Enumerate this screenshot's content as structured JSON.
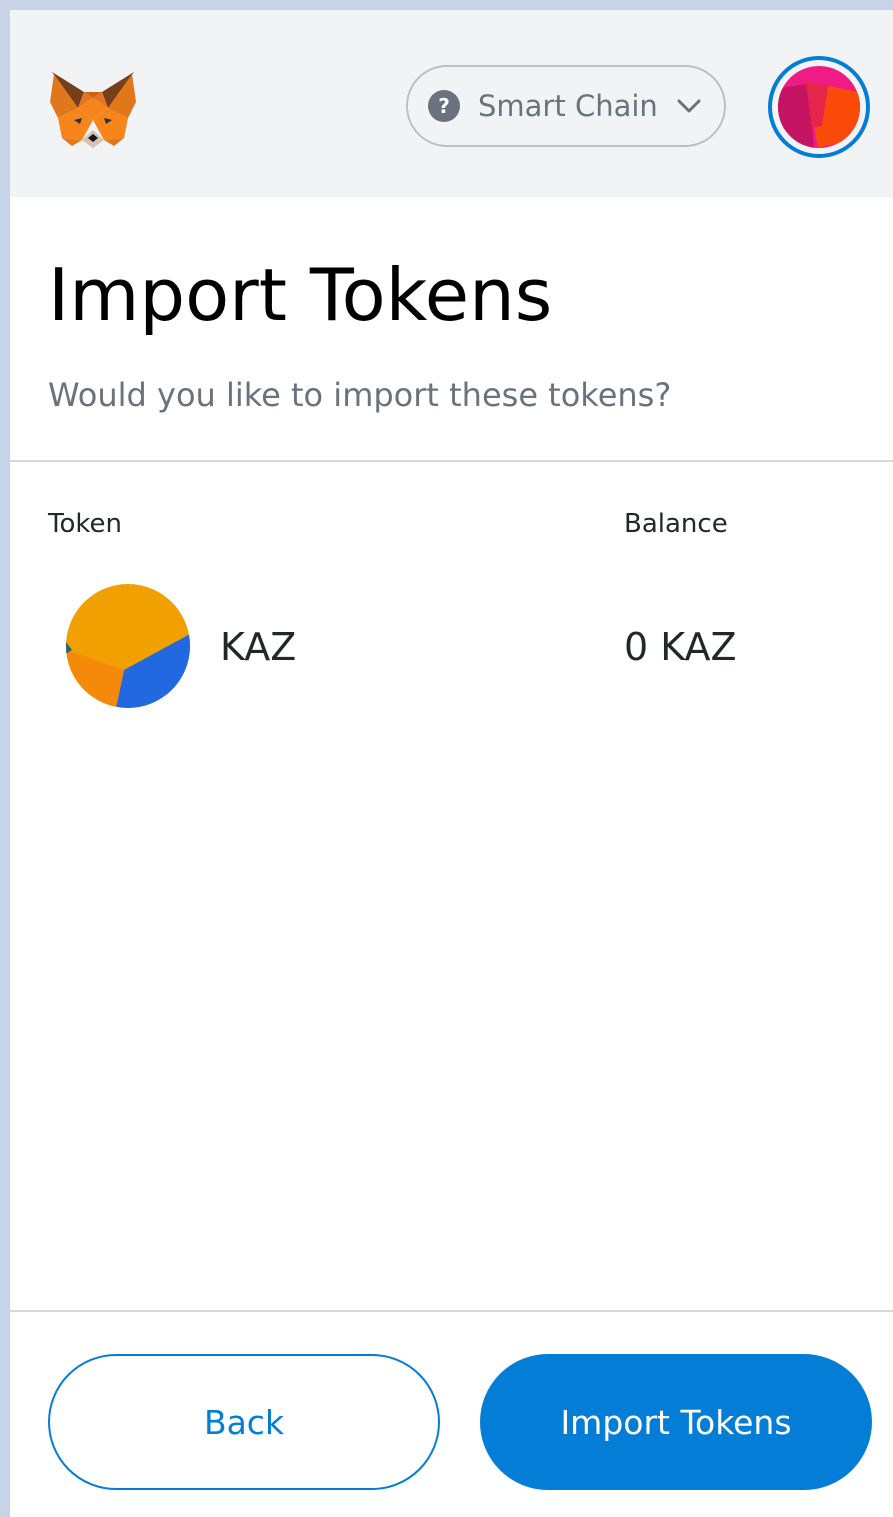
{
  "header": {
    "logo_icon": "metamask-fox-icon",
    "network": {
      "status_icon": "question-circle-icon",
      "label": "Smart Chain",
      "chevron_icon": "chevron-down-icon"
    },
    "account_avatar_icon": "account-identicon-icon"
  },
  "page": {
    "title": "Import Tokens",
    "subtitle": "Would you like to import these tokens?"
  },
  "table": {
    "headers": {
      "token": "Token",
      "balance": "Balance"
    },
    "rows": [
      {
        "icon": "token-identicon-icon",
        "symbol": "KAZ",
        "balance": "0 KAZ"
      }
    ]
  },
  "footer": {
    "back_label": "Back",
    "import_label": "Import Tokens"
  },
  "colors": {
    "primary": "#037dd6",
    "header_bg": "#f2f3f4",
    "text_muted": "#6a737d",
    "divider": "#d6d9dc"
  }
}
